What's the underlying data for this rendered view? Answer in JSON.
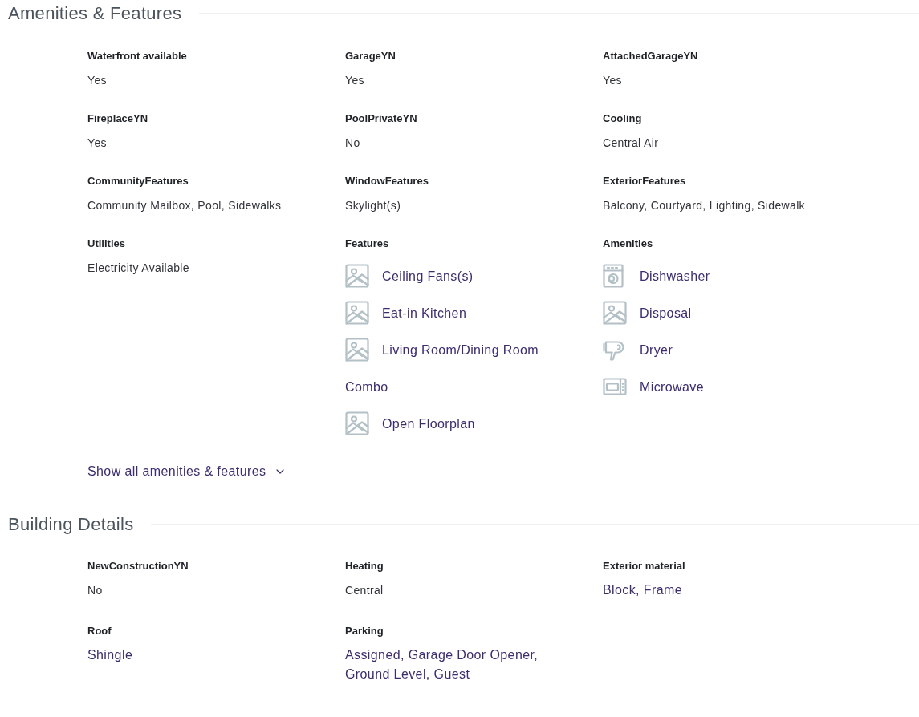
{
  "sections": [
    {
      "title": "Amenities & Features",
      "fields": [
        {
          "label": "Waterfront available",
          "kind": "text",
          "value": "Yes"
        },
        {
          "label": "GarageYN",
          "kind": "text",
          "value": "Yes"
        },
        {
          "label": "AttachedGarageYN",
          "kind": "text",
          "value": "Yes"
        },
        {
          "label": "FireplaceYN",
          "kind": "text",
          "value": "Yes"
        },
        {
          "label": "PoolPrivateYN",
          "kind": "text",
          "value": "No"
        },
        {
          "label": "Cooling",
          "kind": "text",
          "value": "Central Air"
        },
        {
          "label": "CommunityFeatures",
          "kind": "text",
          "value": "Community Mailbox, Pool, Sidewalks"
        },
        {
          "label": "WindowFeatures",
          "kind": "text",
          "value": "Skylight(s)"
        },
        {
          "label": "ExteriorFeatures",
          "kind": "text",
          "value": "Balcony, Courtyard, Lighting, Sidewalk"
        },
        {
          "label": "Utilities",
          "kind": "text",
          "value": "Electricity Available"
        },
        {
          "label": "Features",
          "kind": "list",
          "items": [
            {
              "kind": "photo",
              "text": "Ceiling Fans(s)"
            },
            {
              "kind": "photo",
              "text": "Eat-in Kitchen"
            },
            {
              "kind": "photo",
              "text": "Living Room/Dining Room Combo"
            },
            {
              "kind": "photo",
              "text": "Open Floorplan"
            }
          ]
        },
        {
          "label": "Amenities",
          "kind": "list",
          "items": [
            {
              "kind": "dishwasher",
              "text": "Dishwasher"
            },
            {
              "kind": "photo",
              "text": "Disposal"
            },
            {
              "kind": "dryer",
              "text": "Dryer"
            },
            {
              "kind": "microwave",
              "text": "Microwave"
            }
          ]
        }
      ],
      "show_all": {
        "label": "Show all amenities & features",
        "expanded": false
      }
    },
    {
      "title": "Building Details",
      "fields": [
        {
          "label": "NewConstructionYN",
          "kind": "text",
          "value": "No"
        },
        {
          "label": "Heating",
          "kind": "text",
          "value": "Central"
        },
        {
          "label": "Exterior material",
          "kind": "link",
          "value": "Block, Frame"
        },
        {
          "label": "Roof",
          "kind": "link",
          "value": "Shingle"
        },
        {
          "label": "Parking",
          "kind": "link",
          "value": "Assigned, Garage Door Opener, Ground Level, Guest"
        }
      ]
    }
  ]
}
